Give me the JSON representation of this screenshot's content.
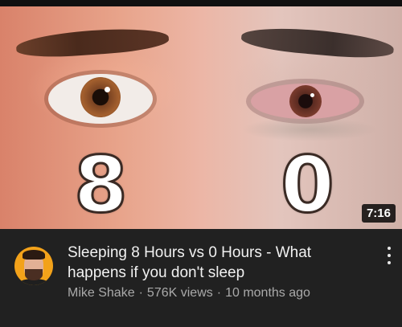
{
  "video": {
    "thumbnail": {
      "left_number": "8",
      "right_number": "0",
      "duration": "7:16"
    },
    "title": "Sleeping 8 Hours vs 0 Hours - What happens if you don't sleep",
    "channel": "Mike Shake",
    "separator": "·",
    "views": "576K views",
    "age": "10 months ago"
  },
  "icons": {
    "menu": "more-vert-icon",
    "avatar": "channel-avatar"
  },
  "colors": {
    "background": "#212121",
    "title": "#f1f1f1",
    "subtext": "#aaaaaa",
    "avatar_bg": "#f3a21a",
    "duration_bg": "#000000"
  }
}
